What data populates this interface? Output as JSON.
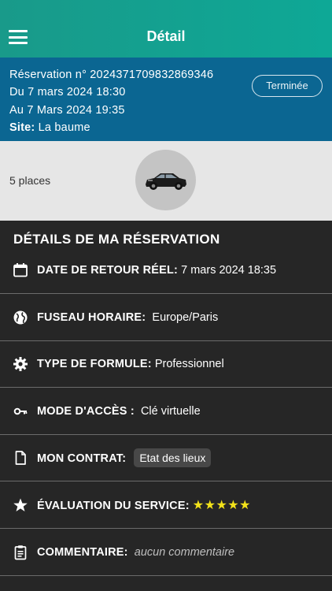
{
  "header": {
    "title": "Détail",
    "menu_icon": "hamburger-menu-icon",
    "bg_color": "#12a08f"
  },
  "reservation": {
    "number_line": "Réservation n° 2024371709832869346",
    "from_line": "Du 7 mars 2024 18:30",
    "to_line": "Au 7 Mars 2024 19:35",
    "site_label": "Site:",
    "site_value": "La baume",
    "status": "Terminée",
    "bg_color": "#0b6692"
  },
  "vehicle": {
    "places": "5  places",
    "image_icon": "car-icon"
  },
  "details": {
    "title": "DÉTAILS DE MA RÉSERVATION",
    "rows": [
      {
        "icon": "calendar-icon",
        "label": "DATE DE RETOUR RÉEL:",
        "value": "7 mars 2024 18:35"
      },
      {
        "icon": "globe-icon",
        "label": "FUSEAU HORAIRE:",
        "value": "Europe/Paris"
      },
      {
        "icon": "gear-icon",
        "label": "TYPE DE FORMULE:",
        "value": "Professionnel"
      },
      {
        "icon": "key-icon",
        "label": "MODE D'ACCÈS :",
        "value": "Clé virtuelle"
      },
      {
        "icon": "document-icon",
        "label": "MON CONTRAT:",
        "value": "Etat des lieux"
      },
      {
        "icon": "star-icon",
        "label": "ÉVALUATION DU SERVICE:",
        "value": "★★★★★",
        "rating": 5,
        "rating_max": 5,
        "rating_color": "#f2e21a"
      },
      {
        "icon": "clipboard-icon",
        "label": "COMMENTAIRE:",
        "value": "aucun commentaire"
      }
    ]
  }
}
